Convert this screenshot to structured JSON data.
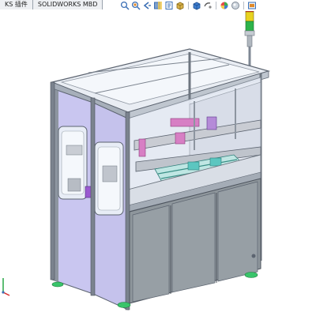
{
  "tabs": [
    {
      "label": "KS 插件",
      "active": false
    },
    {
      "label": "SOLIDWORKS MBD",
      "active": false
    }
  ],
  "toolbar": {
    "icons": [
      "zoom-to-fit-icon",
      "zoom-to-area-icon",
      "previous-view-icon",
      "section-view-icon",
      "dynamic-annotation-icon",
      "view-orientation-icon",
      "display-style-icon",
      "hide-show-items-icon",
      "edit-appearance-icon",
      "apply-scene-icon",
      "view-settings-icon"
    ]
  },
  "model": {
    "colors": {
      "frame": "#8d95a0",
      "frame_dark": "#5c6470",
      "panel_lavender": "#c9c6f0",
      "glass": "#dfe6f4",
      "base_panel": "#8e969c",
      "feet": "#39c46a",
      "tower_red": "#e2232a",
      "tower_yellow": "#e8d21f",
      "tower_green": "#2db34a",
      "accent_pink": "#d77fc4",
      "accent_teal": "#5cc6c0"
    }
  },
  "triad": {
    "axes": [
      "x-axis",
      "y-axis"
    ],
    "colors": [
      "#d62b2b",
      "#28a745"
    ]
  }
}
